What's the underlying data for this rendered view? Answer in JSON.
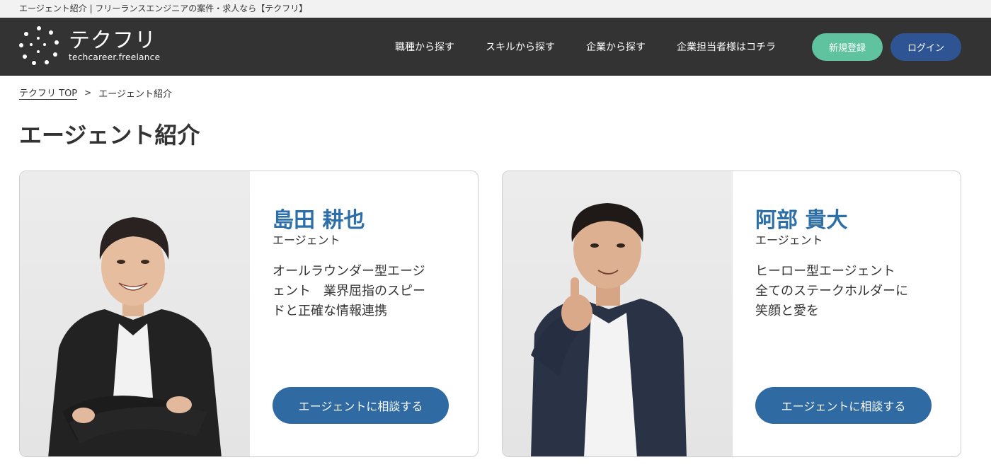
{
  "topbar": {
    "text": "エージェント紹介 | フリーランスエンジニアの案件・求人なら【テクフリ】"
  },
  "header": {
    "logo_name": "テクフリ",
    "logo_sub": "techcareer.freelance",
    "nav": [
      {
        "label": "職種から探す"
      },
      {
        "label": "スキルから探す"
      },
      {
        "label": "企業から探す"
      },
      {
        "label": "企業担当者様はコチラ"
      }
    ],
    "register_label": "新規登録",
    "login_label": "ログイン",
    "colors": {
      "background": "#333333",
      "register": "#5fc3a0",
      "login": "#2f5494"
    }
  },
  "breadcrumb": {
    "home": "テクフリ TOP",
    "separator": ">",
    "current": "エージェント紹介"
  },
  "page_title": "エージェント紹介",
  "agents": [
    {
      "name": "島田 耕也",
      "role": "エージェント",
      "desc_lines": [
        "オールラウンダー型エージ",
        "ェント　業界屈指のスピー",
        "ドと正確な情報連携"
      ],
      "button": "エージェントに相談する"
    },
    {
      "name": "阿部 貴大",
      "role": "エージェント",
      "desc_lines": [
        "ヒーロー型エージェント",
        "全てのステークホルダーに",
        "笑顔と愛を"
      ],
      "button": "エージェントに相談する"
    }
  ],
  "accent_colors": {
    "name": "#2d6fa8",
    "button": "#2f6aa3"
  }
}
